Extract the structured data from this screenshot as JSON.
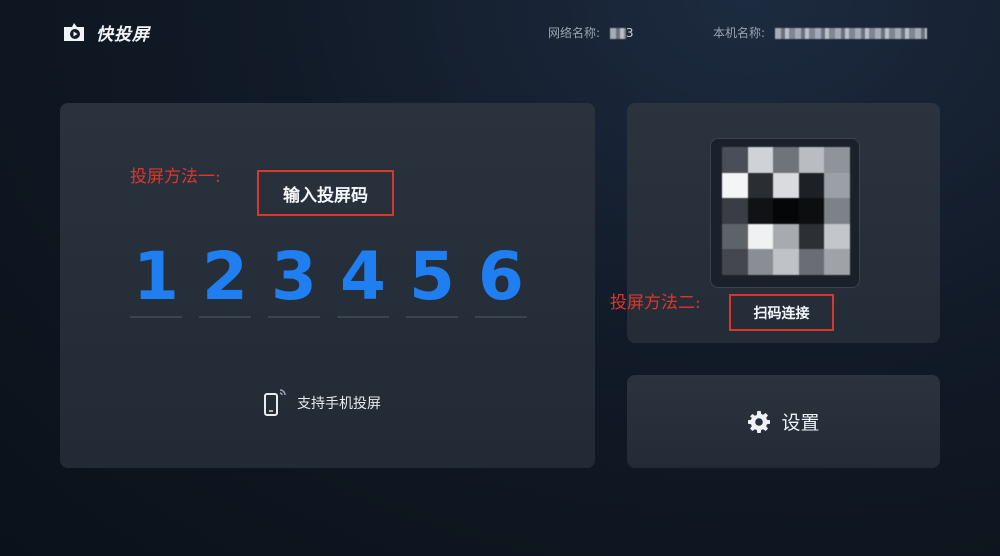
{
  "app": {
    "name": "快投屏"
  },
  "header": {
    "network_label": "网络名称:",
    "network_value": "3",
    "device_label": "本机名称:",
    "device_value": ""
  },
  "method1": {
    "annotation": "投屏方法一:",
    "title": "输入投屏码",
    "code": [
      "1",
      "2",
      "3",
      "4",
      "5",
      "6"
    ],
    "support_text": "支持手机投屏"
  },
  "method2": {
    "annotation": "投屏方法二:",
    "scan_label": "扫码连接"
  },
  "settings": {
    "label": "设置"
  },
  "colors": {
    "accent": "#1f7ff0",
    "annotation": "#e0352b",
    "panel": "#232b37"
  },
  "qr_cells": [
    "#4a4f57",
    "#cfd2d6",
    "#6f747b",
    "#b9bcc1",
    "#8f949a",
    "#f4f5f6",
    "#2a2d32",
    "#d9dbde",
    "#1d2024",
    "#9aa0a6",
    "#3a3e44",
    "#101215",
    "#050607",
    "#0c0e10",
    "#7d8288",
    "#5e636a",
    "#f0f1f2",
    "#a7abb0",
    "#2c2f34",
    "#c3c6ca",
    "#44484e",
    "#8a8e94",
    "#bfc2c6",
    "#6a6e74",
    "#9fa3a8"
  ]
}
